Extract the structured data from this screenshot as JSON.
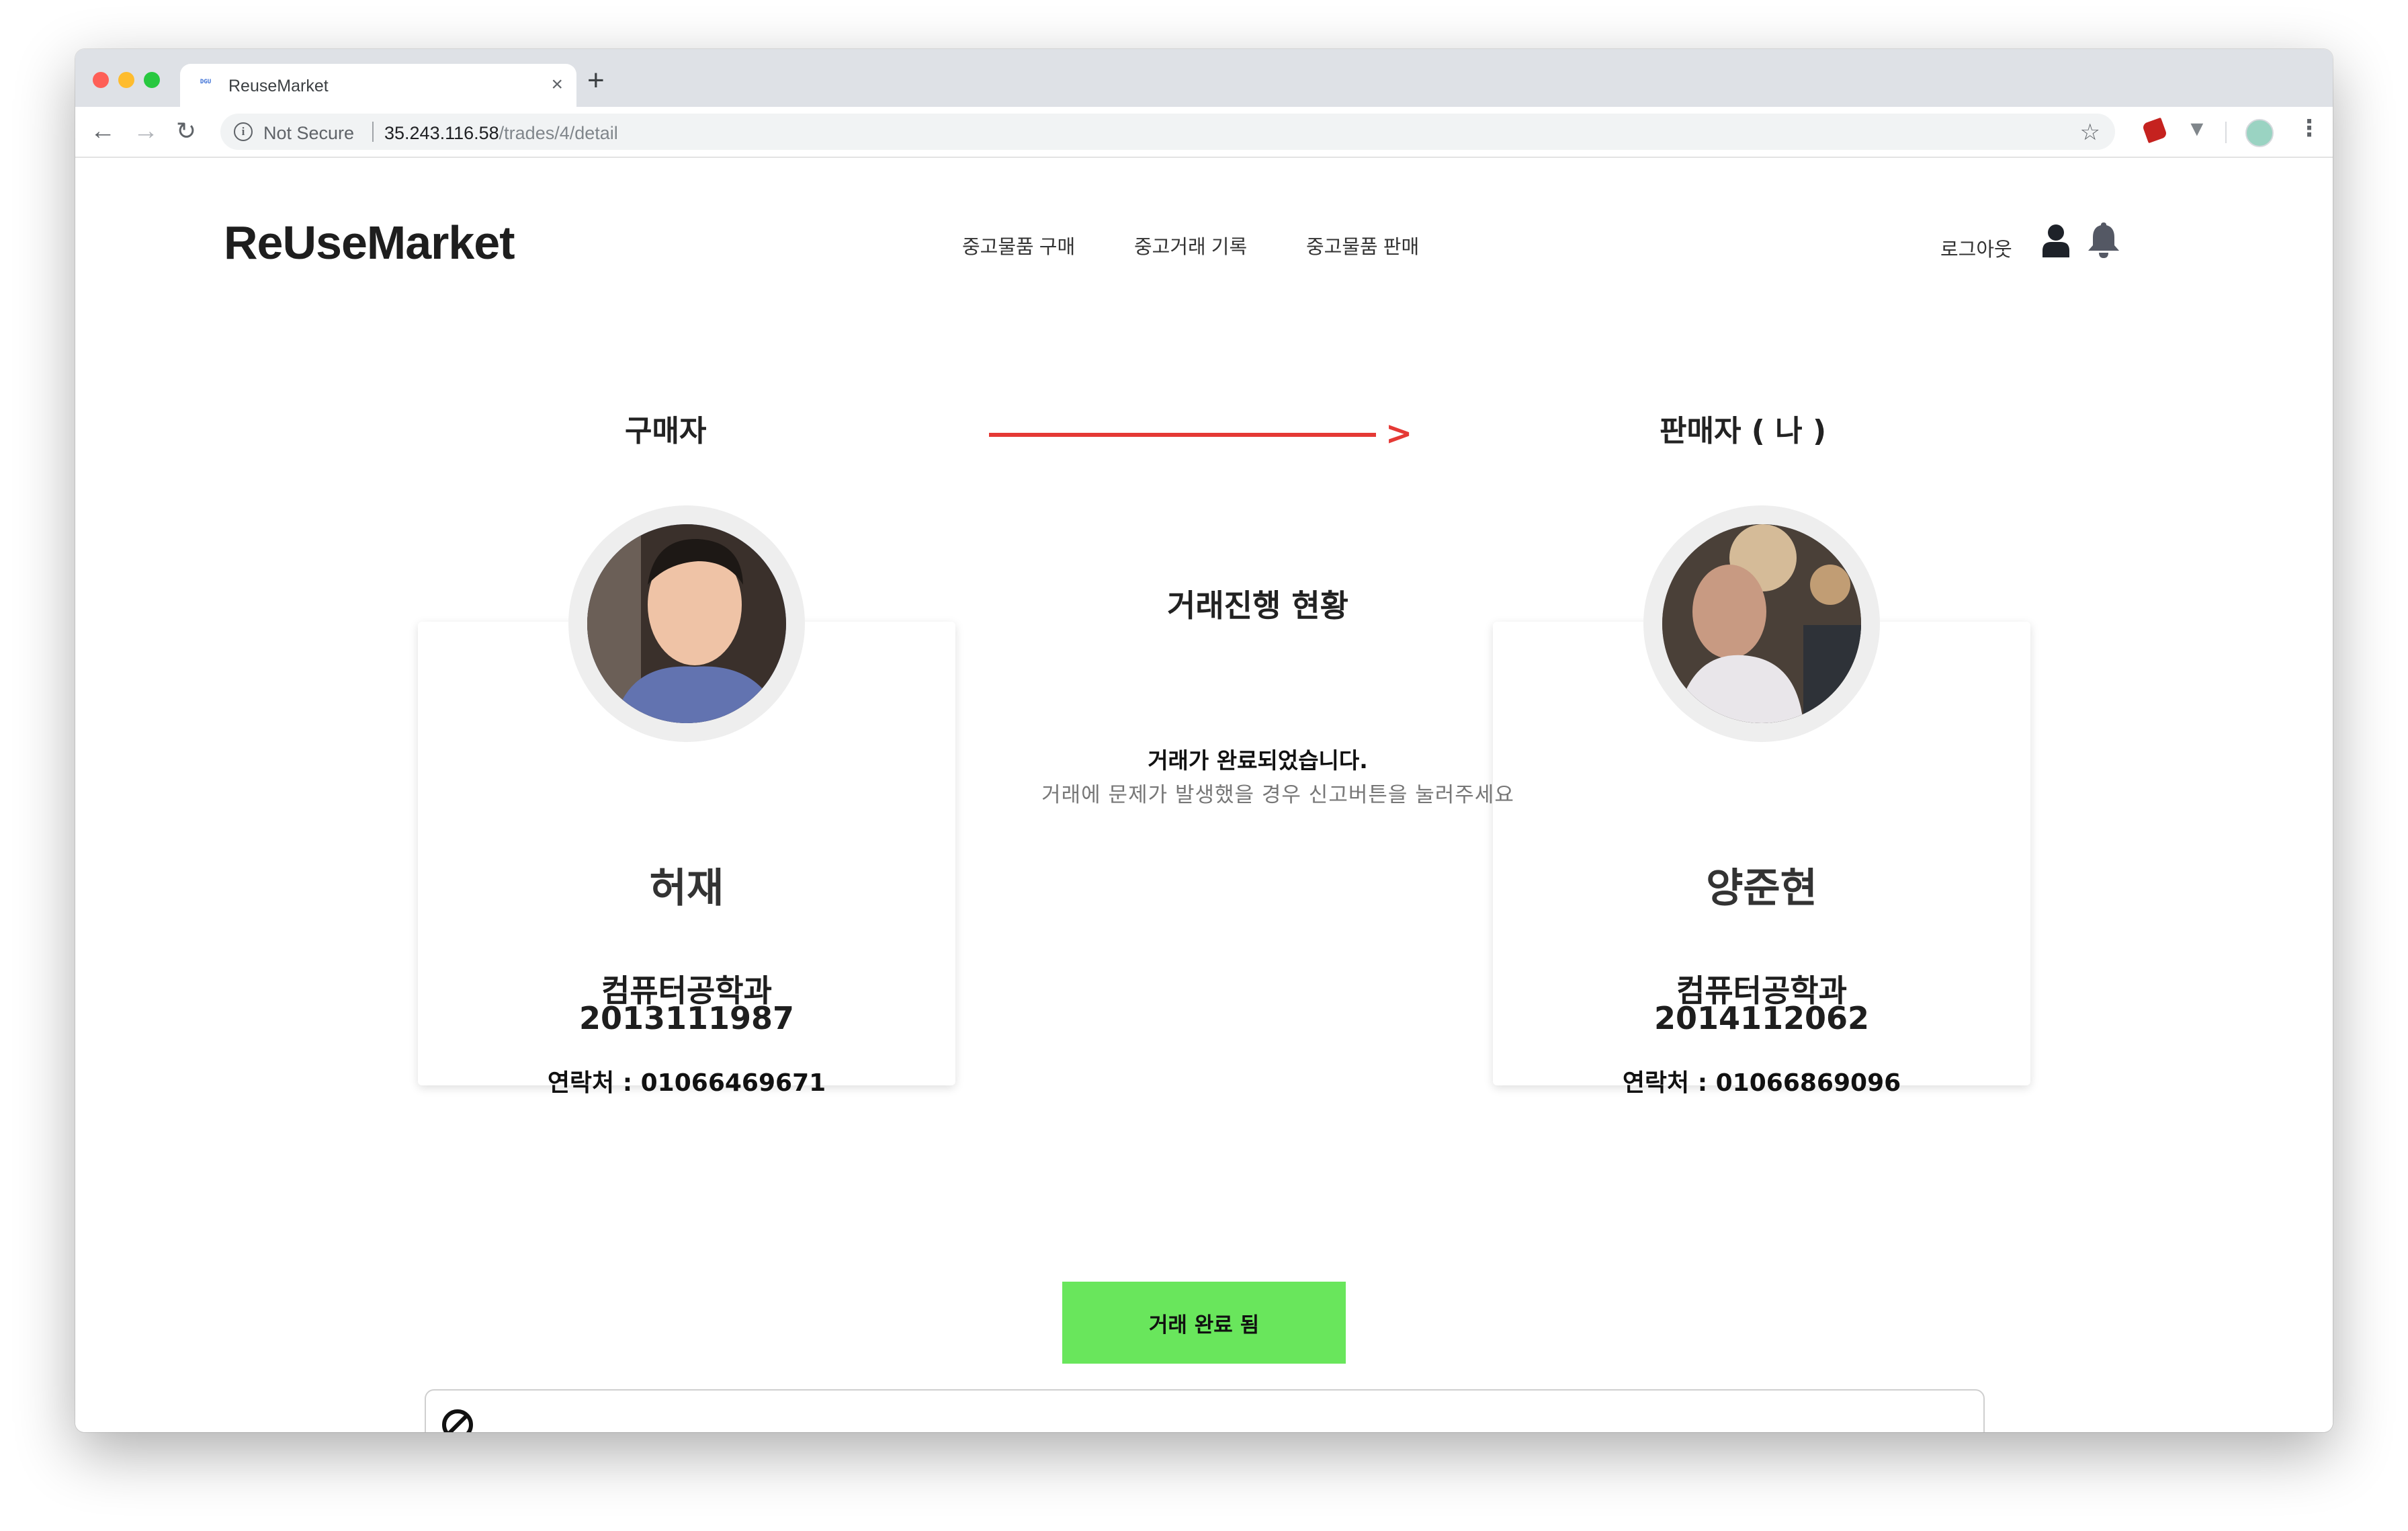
{
  "browser": {
    "tab_title": "ReuseMarket",
    "tab_favicon": "DGU",
    "tab_close": "×",
    "new_tab": "+",
    "not_secure": "Not Secure",
    "url_host": "35.243.116.58",
    "url_path": "/trades/4/detail",
    "icons": [
      "back-icon",
      "forward-icon",
      "reload-icon",
      "info-icon",
      "star-icon",
      "extension-icon",
      "vuejs-icon",
      "profile-icon",
      "menu-icon"
    ]
  },
  "header": {
    "brand": "ReUseMarket",
    "nav": [
      "중고물품 구매",
      "중고거래 기록",
      "중고물품 판매"
    ],
    "logout": "로그아웃"
  },
  "roles": {
    "buyer": "구매자",
    "seller": "판매자 ( 나 )"
  },
  "buyer": {
    "name": "허재",
    "department": "컴퓨터공학과",
    "student_id": "2013111987",
    "contact": "연락처 : 01066469671"
  },
  "seller": {
    "name": "양준현",
    "department": "컴퓨터공학과",
    "student_id": "2014112062",
    "contact": "연락처 : 01066869096"
  },
  "status": {
    "title": "거래진행 현황",
    "done": "거래가 완료되었습니다.",
    "note": "거래에 문제가 발생했을 경우 신고버튼을 눌러주세요"
  },
  "actions": {
    "complete_button": "거래 완료 됨"
  },
  "colors": {
    "arrow": "#e53935",
    "complete_button": "#69e65c"
  }
}
